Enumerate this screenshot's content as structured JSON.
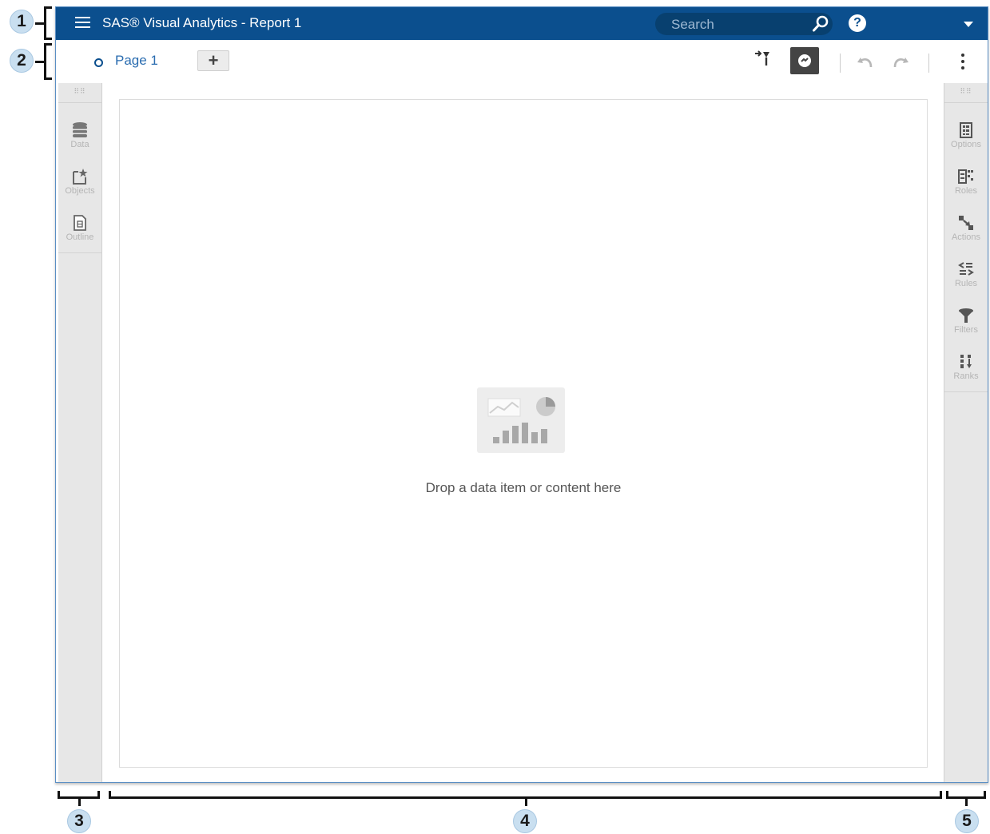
{
  "callouts": [
    "1",
    "2",
    "3",
    "4",
    "5"
  ],
  "app": {
    "title": "SAS® Visual Analytics - Report 1",
    "search_placeholder": "Search",
    "help_glyph": "?"
  },
  "toolbar": {
    "page_tab_label": "Page 1",
    "add_page_glyph": "+"
  },
  "left_pane": {
    "grip": "⠿⠿",
    "items": [
      {
        "label": "Data",
        "icon": "database-icon"
      },
      {
        "label": "Objects",
        "icon": "objects-icon"
      },
      {
        "label": "Outline",
        "icon": "outline-icon"
      }
    ]
  },
  "right_pane": {
    "grip": "⠿⠿",
    "items": [
      {
        "label": "Options",
        "icon": "options-icon"
      },
      {
        "label": "Roles",
        "icon": "roles-icon"
      },
      {
        "label": "Actions",
        "icon": "actions-icon"
      },
      {
        "label": "Rules",
        "icon": "rules-icon"
      },
      {
        "label": "Filters",
        "icon": "filter-icon"
      },
      {
        "label": "Ranks",
        "icon": "ranks-icon"
      }
    ]
  },
  "canvas": {
    "drop_text": "Drop a data item or content here"
  },
  "colors": {
    "titlebar": "#0b4f8e",
    "accent_text": "#2a6cb0",
    "pane_bg": "#e7e7e7"
  }
}
